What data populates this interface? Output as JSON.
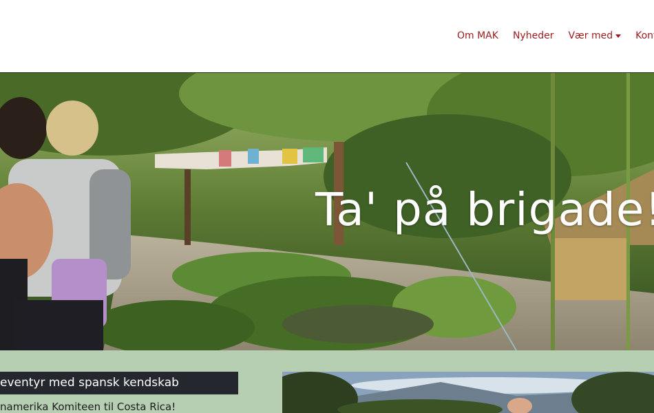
{
  "nav": {
    "items": [
      {
        "label": "Om MAK",
        "dropdown": false
      },
      {
        "label": "Nyheder",
        "dropdown": false
      },
      {
        "label": "Vær med",
        "dropdown": true
      },
      {
        "label": "Kont",
        "dropdown": false
      }
    ]
  },
  "hero": {
    "title": "Ta' på brigade!"
  },
  "card": {
    "title": "eventyr med spansk kendskab",
    "subtitle": "namerika Komiteen til Costa Rica!"
  },
  "colors": {
    "nav_text": "#9b1c1c",
    "section_bg": "#b6cfb2",
    "card_title_bg": "#24282e"
  },
  "icons": {
    "dropdown": "caret-down-icon"
  }
}
